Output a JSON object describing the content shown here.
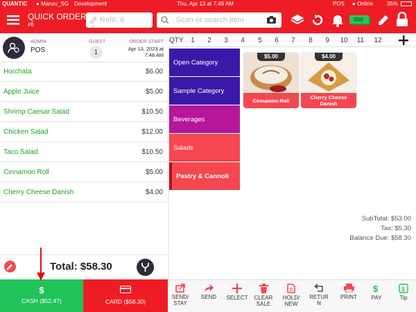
{
  "status_bar": {
    "brand": "QUANTIC",
    "user": "Manav_SG",
    "env": "Development",
    "datetime": "Thu, Apr 13 at 7:49 AM",
    "app": "POS",
    "online": "Online",
    "battery": "35%"
  },
  "header": {
    "title": "QUICK ORDER",
    "order_no": "#6",
    "ref_placeholder": "Ref#: 6",
    "search_placeholder": "Scan or search item"
  },
  "order": {
    "role_label": "ADMIN",
    "user": "POS",
    "guest_label": "GUEST",
    "guest_count": "1",
    "start_label": "ORDER START",
    "start_date": "Apr 13, 2023 at",
    "start_time": "7:48 AM"
  },
  "items": [
    {
      "name": "Horchata",
      "price": "$6.00"
    },
    {
      "name": "Apple Juice",
      "price": "$5.00"
    },
    {
      "name": "Shrimp Caesar Salad",
      "price": "$10.50"
    },
    {
      "name": "Chicken Salad",
      "price": "$12.00"
    },
    {
      "name": "Taco Salad",
      "price": "$10.50"
    },
    {
      "name": "Cinnamon Roll",
      "price": "$5.00"
    },
    {
      "name": "Cherry Cheese Danish",
      "price": "$4.00"
    }
  ],
  "totals": {
    "subtotal": "SubTotal: $53.00",
    "tax": "Tax: $5.30",
    "balance": "Balance Due: $58.30",
    "total": "Total: $58.30"
  },
  "payment": {
    "cash": "CASH ($52.47)",
    "card": "CARD ($58.30)"
  },
  "qty": {
    "label": "QTY",
    "values": [
      "1",
      "2",
      "3",
      "4",
      "5",
      "6",
      "7",
      "8",
      "9",
      "10",
      "11",
      "12"
    ]
  },
  "categories": [
    {
      "label": "Open Category",
      "color": "#3c18a8"
    },
    {
      "label": "Sample Category",
      "color": "#3c18a8"
    },
    {
      "label": "Beverages",
      "color": "#b5169a"
    },
    {
      "label": "Salads",
      "color": "#f44750"
    },
    {
      "label": "Pastry & Cannoli",
      "color": "#f44750"
    }
  ],
  "products": [
    {
      "price": "$5.00",
      "name": "Cinnamon Roll"
    },
    {
      "price": "$4.00",
      "name": "Cherry Cheese Danish"
    }
  ],
  "toolbar": [
    {
      "label": "SEND/ STAY",
      "icon": "send-stay-icon"
    },
    {
      "label": "SEND",
      "icon": "send-icon"
    },
    {
      "label": "SELECT",
      "icon": "plus-icon"
    },
    {
      "label": "CLEAR SALE",
      "icon": "trash-icon"
    },
    {
      "label": "HOLD/ NEW",
      "icon": "hold-icon"
    },
    {
      "label": "RETUR N",
      "icon": "return-icon"
    },
    {
      "label": "PRINT",
      "icon": "print-icon"
    },
    {
      "label": "PAY",
      "icon": "pay-icon"
    },
    {
      "label": "Tip",
      "icon": "tip-icon"
    }
  ],
  "colors": {
    "brand_red": "#ee1c25",
    "green": "#21c35a",
    "pink": "#f44750",
    "purple": "#3c18a8"
  }
}
